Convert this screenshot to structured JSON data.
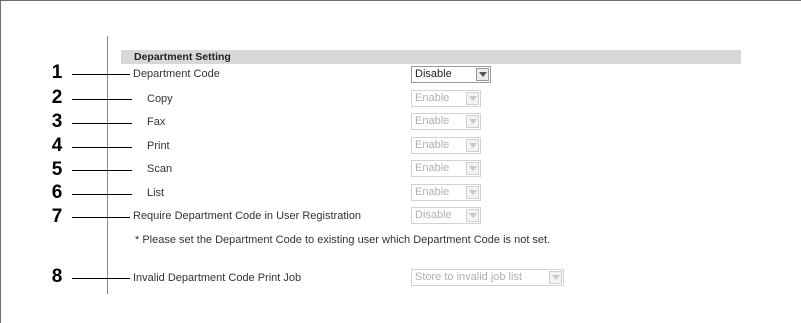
{
  "section_header": "Department Setting",
  "rows": [
    {
      "number": "1",
      "label": "Department Code",
      "value": "Disable",
      "enabled": true
    },
    {
      "number": "2",
      "label": "Copy",
      "value": "Enable",
      "enabled": false
    },
    {
      "number": "3",
      "label": "Fax",
      "value": "Enable",
      "enabled": false
    },
    {
      "number": "4",
      "label": "Print",
      "value": "Enable",
      "enabled": false
    },
    {
      "number": "5",
      "label": "Scan",
      "value": "Enable",
      "enabled": false
    },
    {
      "number": "6",
      "label": "List",
      "value": "Enable",
      "enabled": false
    },
    {
      "number": "7",
      "label": "Require Department Code in User Registration",
      "value": "Disable",
      "enabled": false
    },
    {
      "number": "8",
      "label": "Invalid Department Code Print Job",
      "value": "Store to invalid job list",
      "enabled": false
    }
  ],
  "note": "* Please set the Department Code to existing user which Department Code is not set.",
  "colors": {
    "header_bar": "#d8d8d8",
    "disabled_text": "#b0b0b0",
    "label_text": "#333333"
  }
}
